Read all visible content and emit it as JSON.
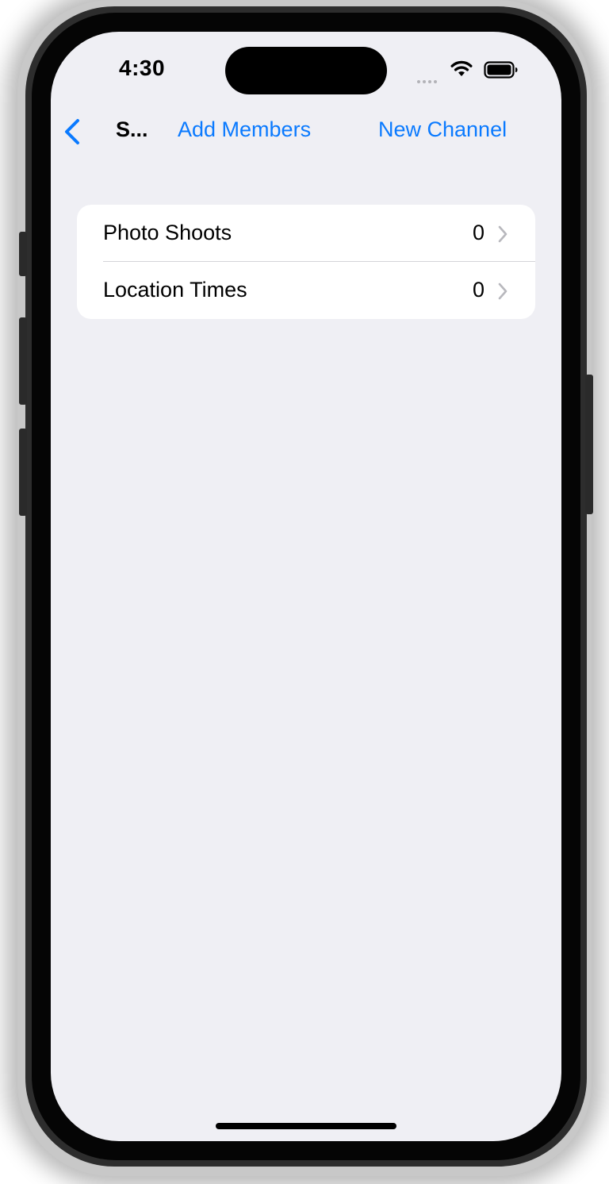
{
  "status_bar": {
    "time": "4:30"
  },
  "nav": {
    "title": "S...",
    "add_members_label": "Add Members",
    "new_channel_label": "New Channel"
  },
  "list": {
    "rows": [
      {
        "label": "Photo Shoots",
        "count": "0"
      },
      {
        "label": "Location Times",
        "count": "0"
      }
    ]
  },
  "colors": {
    "accent": "#0a7aff",
    "background": "#efeff4",
    "card": "#ffffff"
  }
}
